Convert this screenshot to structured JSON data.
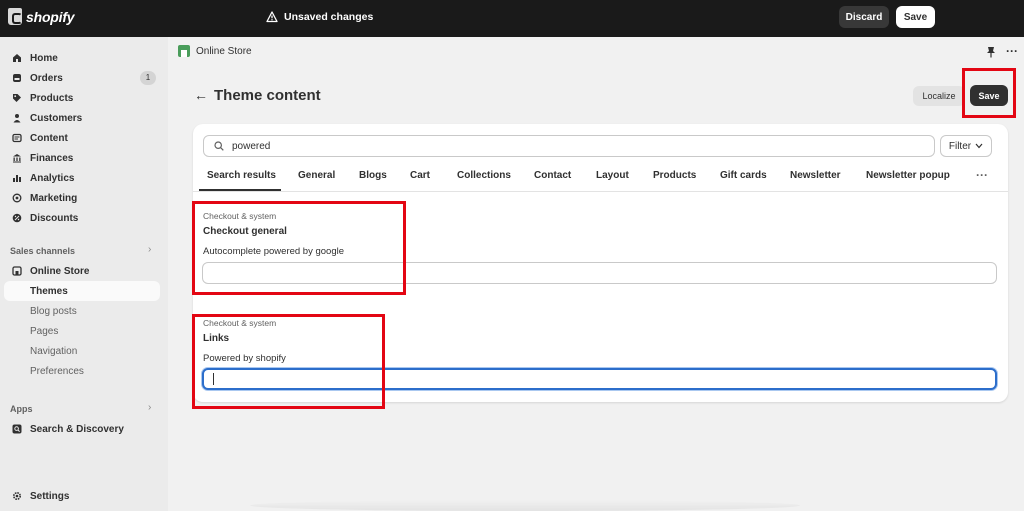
{
  "topbar": {
    "brand": "shopify",
    "status": "Unsaved changes",
    "discard_label": "Discard",
    "save_label": "Save"
  },
  "sidebar": {
    "items": [
      {
        "label": "Home",
        "icon": "home-icon"
      },
      {
        "label": "Orders",
        "icon": "orders-icon",
        "badge": "1"
      },
      {
        "label": "Products",
        "icon": "tag-icon"
      },
      {
        "label": "Customers",
        "icon": "person-icon"
      },
      {
        "label": "Content",
        "icon": "content-icon"
      },
      {
        "label": "Finances",
        "icon": "bank-icon"
      },
      {
        "label": "Analytics",
        "icon": "chart-icon"
      },
      {
        "label": "Marketing",
        "icon": "target-icon"
      },
      {
        "label": "Discounts",
        "icon": "discount-icon"
      }
    ],
    "sales_channels_label": "Sales channels",
    "online_store_label": "Online Store",
    "sub_items": [
      "Themes",
      "Blog posts",
      "Pages",
      "Navigation",
      "Preferences"
    ],
    "apps_label": "Apps",
    "search_discovery_label": "Search & Discovery",
    "settings_label": "Settings"
  },
  "header": {
    "breadcrumb": "Online Store",
    "title": "Theme content",
    "localize_label": "Localize",
    "save_label": "Save"
  },
  "search": {
    "value": "powered",
    "filter_label": "Filter"
  },
  "tabs": [
    "Search results",
    "General",
    "Blogs",
    "Cart",
    "Collections",
    "Contact",
    "Layout",
    "Products",
    "Gift cards",
    "Newsletter",
    "Newsletter popup"
  ],
  "results": [
    {
      "group": "Checkout & system",
      "title": "Checkout general",
      "field_label": "Autocomplete powered by google",
      "value": ""
    },
    {
      "group": "Checkout & system",
      "title": "Links",
      "field_label": "Powered by shopify",
      "value": ""
    }
  ],
  "colors": {
    "topbar": "#1a1a1a",
    "highlight": "#e30613",
    "focus": "#2c6ecb",
    "sidebar": "#ebebeb"
  }
}
